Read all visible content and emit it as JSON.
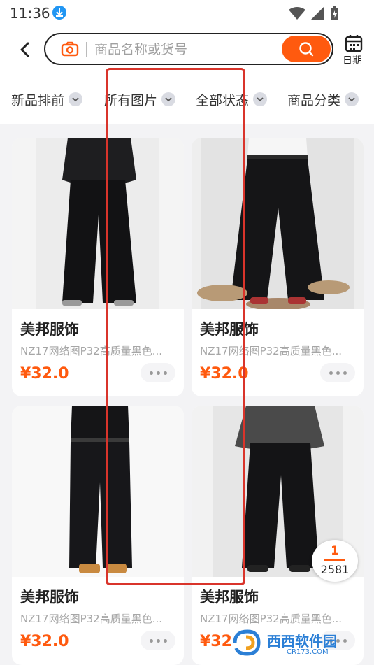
{
  "status_bar": {
    "time": "11:36"
  },
  "header": {
    "search_placeholder": "商品名称或货号",
    "calendar_label": "日期"
  },
  "filters": [
    {
      "label": "新品排前"
    },
    {
      "label": "所有图片"
    },
    {
      "label": "全部状态"
    },
    {
      "label": "商品分类"
    }
  ],
  "products": [
    {
      "shop": "美邦服饰",
      "desc": "NZ17网络图P32高质量黑色...",
      "price": "¥32.0"
    },
    {
      "shop": "美邦服饰",
      "desc": "NZ17网络图P32高质量黑色...",
      "price": "¥32.0"
    },
    {
      "shop": "美邦服饰",
      "desc": "NZ17网络图P32高质量黑色...",
      "price": "¥32.0"
    },
    {
      "shop": "美邦服饰",
      "desc": "NZ17网络图P32高质量黑色...",
      "price": "¥32"
    }
  ],
  "pager": {
    "current": "1",
    "total": "2581"
  },
  "watermark": {
    "brand": "西西软件园",
    "site": "CR173.COM"
  },
  "colors": {
    "accent": "#ff5a0f",
    "highlight": "#d9342b"
  }
}
